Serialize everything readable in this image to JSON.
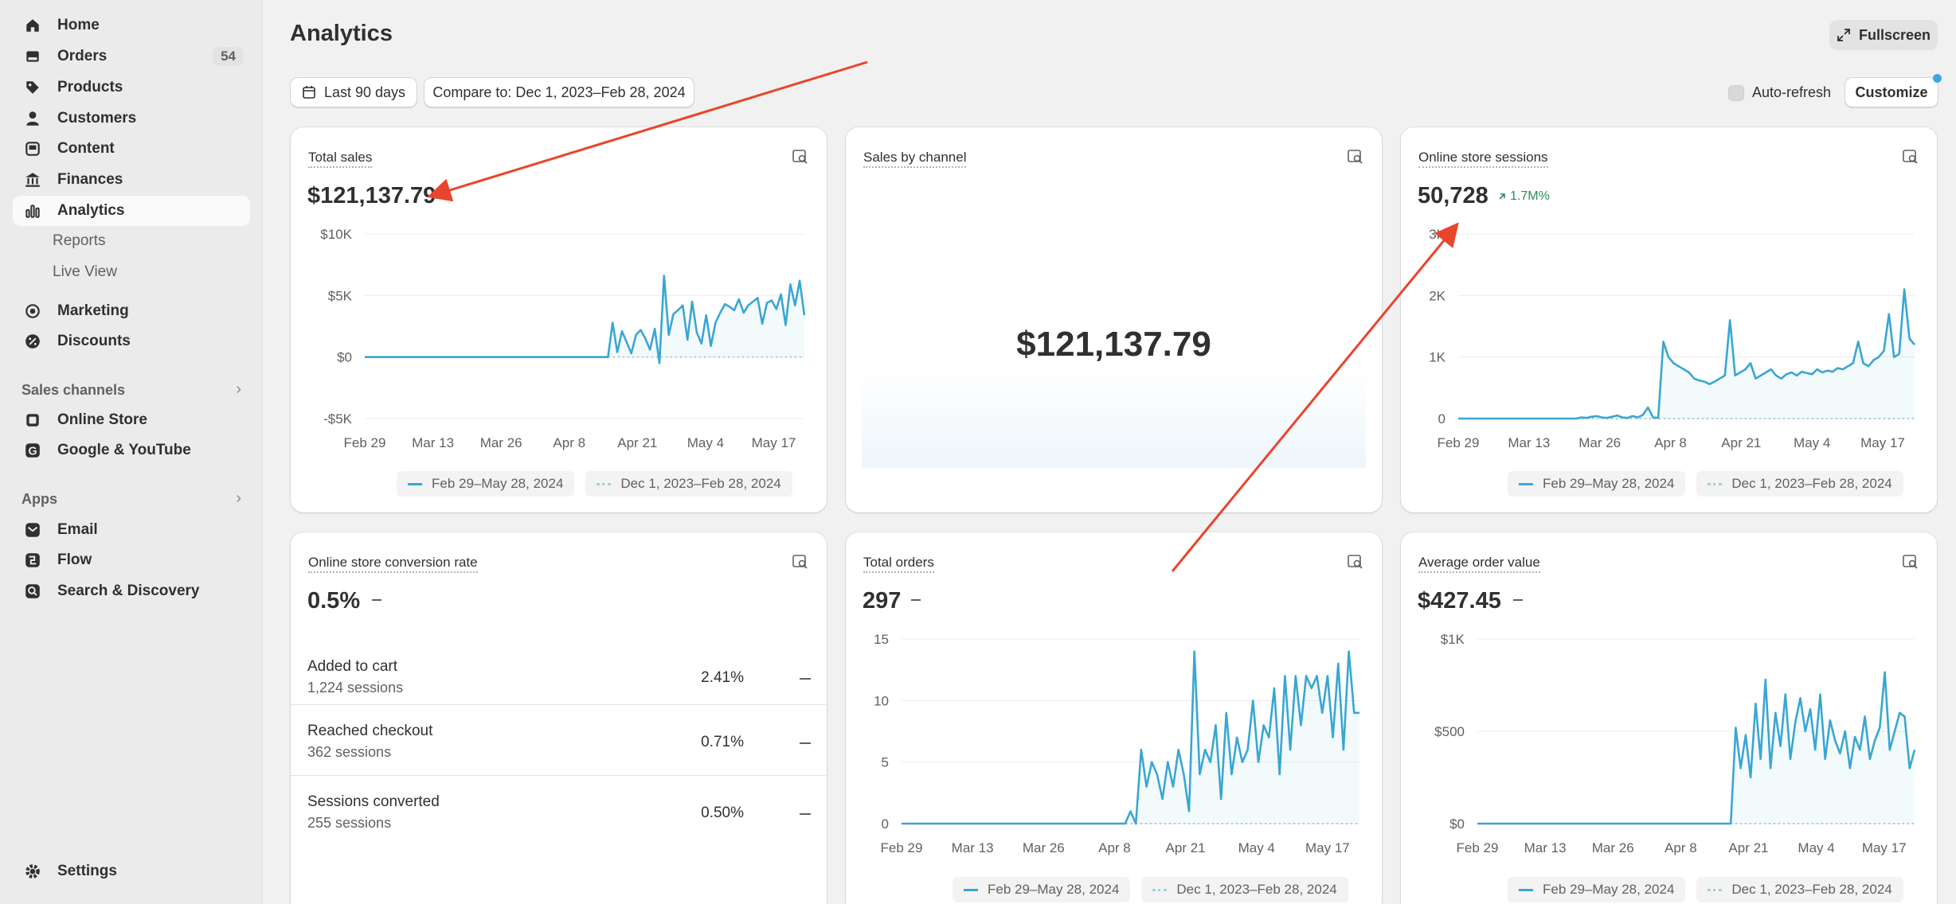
{
  "sidebar": {
    "items": [
      {
        "label": "Home",
        "icon": "home-icon"
      },
      {
        "label": "Orders",
        "icon": "orders-icon",
        "badge": "54"
      },
      {
        "label": "Products",
        "icon": "tag-icon"
      },
      {
        "label": "Customers",
        "icon": "person-icon"
      },
      {
        "label": "Content",
        "icon": "content-icon"
      },
      {
        "label": "Finances",
        "icon": "bank-icon"
      },
      {
        "label": "Analytics",
        "icon": "bar-chart-icon"
      },
      {
        "label": "Reports"
      },
      {
        "label": "Live View"
      },
      {
        "label": "Marketing",
        "icon": "target-icon"
      },
      {
        "label": "Discounts",
        "icon": "discount-icon"
      }
    ],
    "sales_channels_title": "Sales channels",
    "sales_channels": [
      {
        "label": "Online Store",
        "icon": "store-icon"
      },
      {
        "label": "Google & YouTube",
        "icon": "google-icon"
      }
    ],
    "apps_title": "Apps",
    "apps": [
      {
        "label": "Email",
        "icon": "email-icon"
      },
      {
        "label": "Flow",
        "icon": "flow-icon"
      },
      {
        "label": "Search & Discovery",
        "icon": "search-discovery-icon"
      }
    ],
    "settings_label": "Settings"
  },
  "header": {
    "title": "Analytics",
    "fullscreen_label": "Fullscreen",
    "date_range_label": "Last 90 days",
    "compare_label": "Compare to: Dec 1, 2023–Feb 28, 2024",
    "auto_refresh_label": "Auto-refresh",
    "customize_label": "Customize"
  },
  "legend": {
    "current": "Feb 29–May 28, 2024",
    "previous": "Dec 1, 2023–Feb 28, 2024"
  },
  "x_ticks": [
    "Feb 29",
    "Mar 13",
    "Mar 26",
    "Apr 8",
    "Apr 21",
    "May 4",
    "May 17"
  ],
  "cards": {
    "total_sales": {
      "title": "Total sales",
      "value": "$121,137.79",
      "y_ticks": [
        "$10K",
        "$5K",
        "$0",
        "-$5K"
      ]
    },
    "sales_by_channel": {
      "title": "Sales by channel",
      "value": "$121,137.79"
    },
    "sessions": {
      "title": "Online store sessions",
      "value": "50,728",
      "change": "1.7M%",
      "y_ticks": [
        "3K",
        "2K",
        "1K",
        "0"
      ]
    },
    "conversion": {
      "title": "Online store conversion rate",
      "value": "0.5%",
      "rows": [
        {
          "label": "Added to cart",
          "sub": "1,224 sessions",
          "pct": "2.41%"
        },
        {
          "label": "Reached checkout",
          "sub": "362 sessions",
          "pct": "0.71%"
        },
        {
          "label": "Sessions converted",
          "sub": "255 sessions",
          "pct": "0.50%"
        }
      ]
    },
    "total_orders": {
      "title": "Total orders",
      "value": "297",
      "y_ticks": [
        "15",
        "10",
        "5",
        "0"
      ]
    },
    "aov": {
      "title": "Average order value",
      "value": "$427.45",
      "y_ticks": [
        "$1K",
        "$500",
        "$0"
      ]
    }
  },
  "colors": {
    "series": "#3aa6d2",
    "annotation_arrow": "#e8452c",
    "positive": "#2e8b57"
  },
  "chart_data": [
    {
      "type": "line",
      "title": "Total sales",
      "ylim": [
        -5000,
        10000
      ],
      "series": [
        {
          "name": "Feb 29–May 28, 2024",
          "values": [
            0,
            0,
            0,
            0,
            0,
            0,
            0,
            0,
            0,
            0,
            0,
            0,
            0,
            0,
            0,
            0,
            0,
            0,
            0,
            0,
            0,
            0,
            0,
            0,
            0,
            0,
            0,
            0,
            0,
            0,
            0,
            0,
            0,
            0,
            0,
            0,
            0,
            0,
            0,
            0,
            0,
            0,
            0,
            0,
            0,
            0,
            0,
            0,
            0,
            0,
            0,
            0,
            0,
            2800,
            400,
            2100,
            1200,
            300,
            1800,
            2200,
            1500,
            600,
            2300,
            -500,
            6600,
            1800,
            3500,
            3800,
            4200,
            1400,
            4500,
            2000,
            1100,
            3400,
            900,
            2800,
            3600,
            4300,
            4100,
            3800,
            4700,
            3600,
            4200,
            4500,
            4800,
            2700,
            4400,
            4600,
            3900,
            5100,
            2600,
            5900,
            4200,
            6200,
            3400
          ]
        }
      ]
    },
    {
      "type": "line",
      "title": "Online store sessions",
      "ylim": [
        0,
        3000
      ],
      "series": [
        {
          "name": "Feb 29–May 28, 2024",
          "values": [
            0,
            0,
            0,
            0,
            0,
            0,
            0,
            0,
            0,
            0,
            0,
            0,
            0,
            0,
            0,
            0,
            0,
            0,
            0,
            0,
            0,
            0,
            0,
            0,
            20,
            10,
            30,
            40,
            20,
            10,
            30,
            50,
            20,
            10,
            40,
            20,
            60,
            180,
            20,
            10,
            1250,
            1000,
            900,
            850,
            800,
            750,
            650,
            620,
            600,
            560,
            600,
            650,
            700,
            1600,
            700,
            750,
            800,
            900,
            650,
            700,
            750,
            800,
            700,
            650,
            720,
            750,
            700,
            760,
            740,
            720,
            800,
            750,
            780,
            760,
            820,
            800,
            850,
            900,
            1250,
            900,
            850,
            950,
            1000,
            1100,
            1700,
            1000,
            1050,
            2100,
            1300,
            1200
          ]
        }
      ]
    },
    {
      "type": "line",
      "title": "Total orders",
      "ylim": [
        0,
        15
      ],
      "series": [
        {
          "name": "Feb 29–May 28, 2024",
          "values": [
            0,
            0,
            0,
            0,
            0,
            0,
            0,
            0,
            0,
            0,
            0,
            0,
            0,
            0,
            0,
            0,
            0,
            0,
            0,
            0,
            0,
            0,
            0,
            0,
            0,
            0,
            0,
            0,
            0,
            0,
            0,
            0,
            0,
            0,
            0,
            0,
            0,
            0,
            0,
            0,
            0,
            0,
            0,
            1,
            0,
            6,
            3,
            5,
            4,
            2,
            5,
            3,
            6,
            4,
            1,
            14,
            4,
            6,
            5,
            8,
            2,
            9,
            4,
            7,
            5,
            6,
            10,
            5,
            8,
            7,
            11,
            4,
            12,
            6,
            12,
            8,
            12,
            11,
            12,
            9,
            12,
            7,
            13,
            6,
            14,
            9,
            9
          ]
        }
      ]
    },
    {
      "type": "line",
      "title": "Average order value",
      "ylim": [
        0,
        1000
      ],
      "series": [
        {
          "name": "Feb 29–May 28, 2024",
          "values": [
            0,
            0,
            0,
            0,
            0,
            0,
            0,
            0,
            0,
            0,
            0,
            0,
            0,
            0,
            0,
            0,
            0,
            0,
            0,
            0,
            0,
            0,
            0,
            0,
            0,
            0,
            0,
            0,
            0,
            0,
            0,
            0,
            0,
            0,
            0,
            0,
            0,
            0,
            0,
            0,
            0,
            0,
            0,
            0,
            0,
            0,
            0,
            0,
            0,
            0,
            0,
            0,
            520,
            300,
            480,
            250,
            650,
            350,
            780,
            300,
            600,
            420,
            700,
            350,
            550,
            680,
            500,
            620,
            400,
            700,
            350,
            560,
            450,
            380,
            500,
            300,
            470,
            400,
            580,
            350,
            450,
            520,
            820,
            400,
            500,
            600,
            580,
            300,
            400
          ]
        }
      ]
    }
  ]
}
